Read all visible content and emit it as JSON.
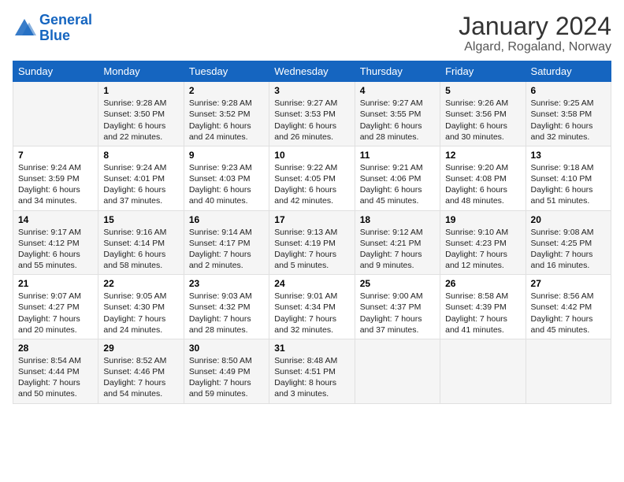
{
  "header": {
    "logo": {
      "line1": "General",
      "line2": "Blue"
    },
    "title": "January 2024",
    "subtitle": "Algard, Rogaland, Norway"
  },
  "weekdays": [
    "Sunday",
    "Monday",
    "Tuesday",
    "Wednesday",
    "Thursday",
    "Friday",
    "Saturday"
  ],
  "weeks": [
    [
      {
        "day": "",
        "sunrise": "",
        "sunset": "",
        "daylight": ""
      },
      {
        "day": "1",
        "sunrise": "Sunrise: 9:28 AM",
        "sunset": "Sunset: 3:50 PM",
        "daylight": "Daylight: 6 hours and 22 minutes."
      },
      {
        "day": "2",
        "sunrise": "Sunrise: 9:28 AM",
        "sunset": "Sunset: 3:52 PM",
        "daylight": "Daylight: 6 hours and 24 minutes."
      },
      {
        "day": "3",
        "sunrise": "Sunrise: 9:27 AM",
        "sunset": "Sunset: 3:53 PM",
        "daylight": "Daylight: 6 hours and 26 minutes."
      },
      {
        "day": "4",
        "sunrise": "Sunrise: 9:27 AM",
        "sunset": "Sunset: 3:55 PM",
        "daylight": "Daylight: 6 hours and 28 minutes."
      },
      {
        "day": "5",
        "sunrise": "Sunrise: 9:26 AM",
        "sunset": "Sunset: 3:56 PM",
        "daylight": "Daylight: 6 hours and 30 minutes."
      },
      {
        "day": "6",
        "sunrise": "Sunrise: 9:25 AM",
        "sunset": "Sunset: 3:58 PM",
        "daylight": "Daylight: 6 hours and 32 minutes."
      }
    ],
    [
      {
        "day": "7",
        "sunrise": "Sunrise: 9:24 AM",
        "sunset": "Sunset: 3:59 PM",
        "daylight": "Daylight: 6 hours and 34 minutes."
      },
      {
        "day": "8",
        "sunrise": "Sunrise: 9:24 AM",
        "sunset": "Sunset: 4:01 PM",
        "daylight": "Daylight: 6 hours and 37 minutes."
      },
      {
        "day": "9",
        "sunrise": "Sunrise: 9:23 AM",
        "sunset": "Sunset: 4:03 PM",
        "daylight": "Daylight: 6 hours and 40 minutes."
      },
      {
        "day": "10",
        "sunrise": "Sunrise: 9:22 AM",
        "sunset": "Sunset: 4:05 PM",
        "daylight": "Daylight: 6 hours and 42 minutes."
      },
      {
        "day": "11",
        "sunrise": "Sunrise: 9:21 AM",
        "sunset": "Sunset: 4:06 PM",
        "daylight": "Daylight: 6 hours and 45 minutes."
      },
      {
        "day": "12",
        "sunrise": "Sunrise: 9:20 AM",
        "sunset": "Sunset: 4:08 PM",
        "daylight": "Daylight: 6 hours and 48 minutes."
      },
      {
        "day": "13",
        "sunrise": "Sunrise: 9:18 AM",
        "sunset": "Sunset: 4:10 PM",
        "daylight": "Daylight: 6 hours and 51 minutes."
      }
    ],
    [
      {
        "day": "14",
        "sunrise": "Sunrise: 9:17 AM",
        "sunset": "Sunset: 4:12 PM",
        "daylight": "Daylight: 6 hours and 55 minutes."
      },
      {
        "day": "15",
        "sunrise": "Sunrise: 9:16 AM",
        "sunset": "Sunset: 4:14 PM",
        "daylight": "Daylight: 6 hours and 58 minutes."
      },
      {
        "day": "16",
        "sunrise": "Sunrise: 9:14 AM",
        "sunset": "Sunset: 4:17 PM",
        "daylight": "Daylight: 7 hours and 2 minutes."
      },
      {
        "day": "17",
        "sunrise": "Sunrise: 9:13 AM",
        "sunset": "Sunset: 4:19 PM",
        "daylight": "Daylight: 7 hours and 5 minutes."
      },
      {
        "day": "18",
        "sunrise": "Sunrise: 9:12 AM",
        "sunset": "Sunset: 4:21 PM",
        "daylight": "Daylight: 7 hours and 9 minutes."
      },
      {
        "day": "19",
        "sunrise": "Sunrise: 9:10 AM",
        "sunset": "Sunset: 4:23 PM",
        "daylight": "Daylight: 7 hours and 12 minutes."
      },
      {
        "day": "20",
        "sunrise": "Sunrise: 9:08 AM",
        "sunset": "Sunset: 4:25 PM",
        "daylight": "Daylight: 7 hours and 16 minutes."
      }
    ],
    [
      {
        "day": "21",
        "sunrise": "Sunrise: 9:07 AM",
        "sunset": "Sunset: 4:27 PM",
        "daylight": "Daylight: 7 hours and 20 minutes."
      },
      {
        "day": "22",
        "sunrise": "Sunrise: 9:05 AM",
        "sunset": "Sunset: 4:30 PM",
        "daylight": "Daylight: 7 hours and 24 minutes."
      },
      {
        "day": "23",
        "sunrise": "Sunrise: 9:03 AM",
        "sunset": "Sunset: 4:32 PM",
        "daylight": "Daylight: 7 hours and 28 minutes."
      },
      {
        "day": "24",
        "sunrise": "Sunrise: 9:01 AM",
        "sunset": "Sunset: 4:34 PM",
        "daylight": "Daylight: 7 hours and 32 minutes."
      },
      {
        "day": "25",
        "sunrise": "Sunrise: 9:00 AM",
        "sunset": "Sunset: 4:37 PM",
        "daylight": "Daylight: 7 hours and 37 minutes."
      },
      {
        "day": "26",
        "sunrise": "Sunrise: 8:58 AM",
        "sunset": "Sunset: 4:39 PM",
        "daylight": "Daylight: 7 hours and 41 minutes."
      },
      {
        "day": "27",
        "sunrise": "Sunrise: 8:56 AM",
        "sunset": "Sunset: 4:42 PM",
        "daylight": "Daylight: 7 hours and 45 minutes."
      }
    ],
    [
      {
        "day": "28",
        "sunrise": "Sunrise: 8:54 AM",
        "sunset": "Sunset: 4:44 PM",
        "daylight": "Daylight: 7 hours and 50 minutes."
      },
      {
        "day": "29",
        "sunrise": "Sunrise: 8:52 AM",
        "sunset": "Sunset: 4:46 PM",
        "daylight": "Daylight: 7 hours and 54 minutes."
      },
      {
        "day": "30",
        "sunrise": "Sunrise: 8:50 AM",
        "sunset": "Sunset: 4:49 PM",
        "daylight": "Daylight: 7 hours and 59 minutes."
      },
      {
        "day": "31",
        "sunrise": "Sunrise: 8:48 AM",
        "sunset": "Sunset: 4:51 PM",
        "daylight": "Daylight: 8 hours and 3 minutes."
      },
      {
        "day": "",
        "sunrise": "",
        "sunset": "",
        "daylight": ""
      },
      {
        "day": "",
        "sunrise": "",
        "sunset": "",
        "daylight": ""
      },
      {
        "day": "",
        "sunrise": "",
        "sunset": "",
        "daylight": ""
      }
    ]
  ]
}
